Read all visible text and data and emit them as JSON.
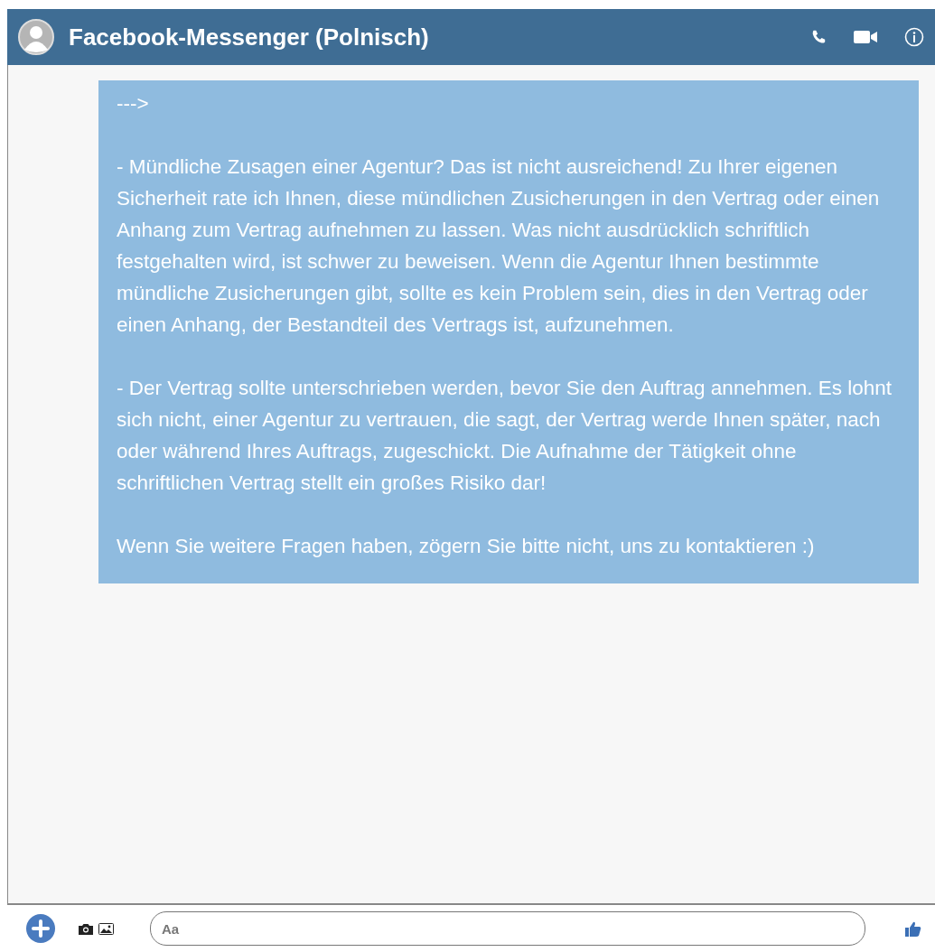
{
  "window": {
    "title": "Facebook-Messenger (Polnisch)"
  },
  "messages": [
    {
      "paragraphs": [
        "--->",
        "- Mündliche Zusagen einer Agentur? Das ist nicht ausreichend! Zu Ihrer eigenen Sicherheit rate ich Ihnen, diese mündlichen Zusicherungen in den Vertrag oder einen Anhang zum Vertrag aufnehmen zu lassen. Was nicht ausdrücklich schriftlich festgehalten wird, ist schwer zu beweisen. Wenn die Agentur Ihnen bestimmte mündliche Zusicherungen gibt, sollte es kein Problem sein, dies in den Vertrag oder einen Anhang, der Bestandteil des Vertrags ist, aufzunehmen.",
        "- Der Vertrag sollte unterschrieben werden, bevor Sie den Auftrag annehmen. Es lohnt sich nicht, einer Agentur zu vertrauen, die sagt, der Vertrag werde Ihnen später, nach oder während Ihres Auftrags, zugeschickt. Die Aufnahme der Tätigkeit ohne schriftlichen Vertrag stellt ein großes Risiko dar!",
        "Wenn Sie weitere Fragen haben, zögern Sie bitte nicht, uns zu kontaktieren :)"
      ]
    }
  ],
  "composer": {
    "placeholder": "Aa"
  }
}
